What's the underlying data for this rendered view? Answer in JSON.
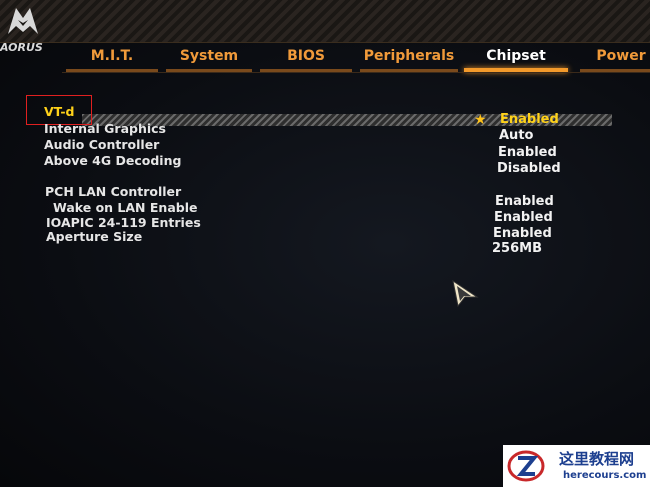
{
  "brand": {
    "logo_text": "AORUS"
  },
  "tabs": [
    {
      "label": "M.I.T.",
      "active": false
    },
    {
      "label": "System",
      "active": false
    },
    {
      "label": "BIOS",
      "active": false
    },
    {
      "label": "Peripherals",
      "active": false
    },
    {
      "label": "Chipset",
      "active": true
    },
    {
      "label": "Power",
      "active": false
    }
  ],
  "settings": [
    {
      "label": "VT-d",
      "value": "Enabled",
      "selected": true
    },
    {
      "label": "Internal Graphics",
      "value": "Auto"
    },
    {
      "label": "Audio Controller",
      "value": "Enabled"
    },
    {
      "label": "Above 4G Decoding",
      "value": "Disabled"
    },
    {
      "label": "PCH LAN Controller",
      "value": "Enabled"
    },
    {
      "label": "Wake on LAN Enable",
      "value": "Enabled"
    },
    {
      "label": "IOAPIC 24-119 Entries",
      "value": "Enabled"
    },
    {
      "label": "Aperture Size",
      "value": "256MB"
    }
  ],
  "watermark": {
    "title": "这里教程网",
    "url": "herecours.com"
  },
  "colors": {
    "accent": "#f39a2b",
    "selected": "#ffd21a",
    "highlight_box": "#e02020"
  }
}
